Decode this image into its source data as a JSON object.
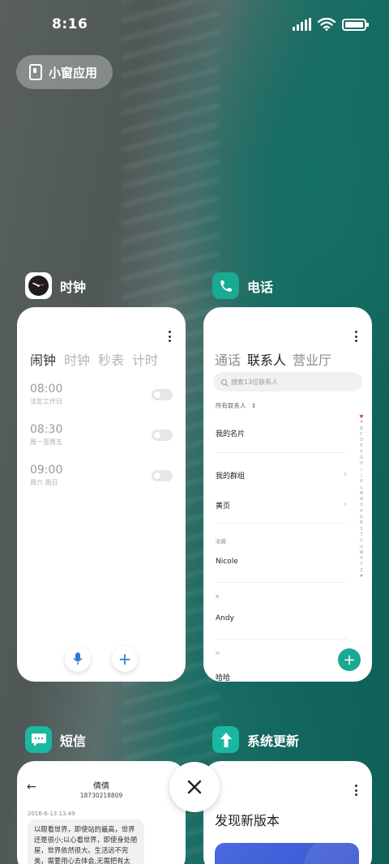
{
  "status_bar": {
    "time": "8:16"
  },
  "mini_window": {
    "label": "小窗应用"
  },
  "cards": {
    "clock": {
      "title": "时钟",
      "tabs": [
        "闹钟",
        "时钟",
        "秒表",
        "计时"
      ],
      "alarms": [
        {
          "time": "08:00",
          "repeat": "法定工作日",
          "enabled": false
        },
        {
          "time": "08:30",
          "repeat": "周一至周五",
          "enabled": false
        },
        {
          "time": "09:00",
          "repeat": "周六 周日",
          "enabled": false
        }
      ],
      "add_icon": "+"
    },
    "phone": {
      "title": "电话",
      "tabs": [
        "通话",
        "联系人",
        "营业厅"
      ],
      "search_placeholder": "搜索13位联系人",
      "filter": "所有联系人",
      "rows": {
        "my_card": "我的名片",
        "my_groups": "我的群组",
        "yellow_pages": "黄页"
      },
      "sections": {
        "favorites": "收藏",
        "a": "A",
        "h": "H"
      },
      "contacts": {
        "fav": "Nicole",
        "a": "Andy",
        "h": "哈哈"
      },
      "alpha_index": [
        "A",
        "B",
        "C",
        "D",
        "E",
        "F",
        "G",
        "H",
        "I",
        "J",
        "K",
        "L",
        "M",
        "N",
        "O",
        "P",
        "Q",
        "R",
        "S",
        "T",
        "U",
        "V",
        "W",
        "X",
        "Y",
        "Z",
        "#"
      ],
      "fab_icon": "+"
    },
    "sms": {
      "title": "短信",
      "contact_name": "倩倩",
      "contact_number": "18730218809",
      "timestamp": "2016-6-13 13:49",
      "message": "以眼看世界，即使站的最高，世界还是很小;以心看世界，即使身处陋屋，世界依然很大。生活远不完美，需要用心去体会,无需把有太"
    },
    "update": {
      "title": "系统更新",
      "headline": "发现新版本"
    }
  },
  "colors": {
    "phone_green": "#1aaa91",
    "accent_blue": "#2a7bd8",
    "update_blue": "#3d5ed8"
  }
}
